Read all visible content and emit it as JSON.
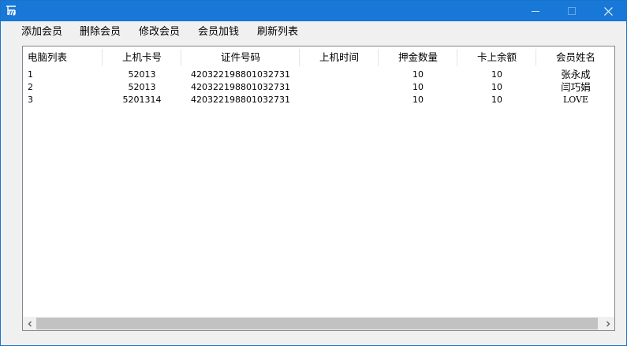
{
  "window": {
    "accent": "#1878d7",
    "icons": {
      "app": "app-icon",
      "minimize": "minimize-icon",
      "maximize": "maximize-icon",
      "close": "close-icon"
    }
  },
  "menu": {
    "items": [
      "添加会员",
      "删除会员",
      "修改会员",
      "会员加钱",
      "刷新列表"
    ]
  },
  "table": {
    "columns": [
      "电脑列表",
      "上机卡号",
      "证件号码",
      "上机时间",
      "押金数量",
      "卡上余额",
      "会员姓名"
    ],
    "rows": [
      [
        "1",
        "52013",
        "420322198801032731",
        "",
        "10",
        "10",
        "张永成"
      ],
      [
        "2",
        "52013",
        "420322198801032731",
        "",
        "10",
        "10",
        "闫巧娟"
      ],
      [
        "3",
        "5201314",
        "420322198801032731",
        "",
        "10",
        "10",
        "LOVE"
      ]
    ]
  },
  "scrollbar": {
    "left_arrow": "chevron-left-icon",
    "right_arrow": "chevron-right-icon"
  }
}
